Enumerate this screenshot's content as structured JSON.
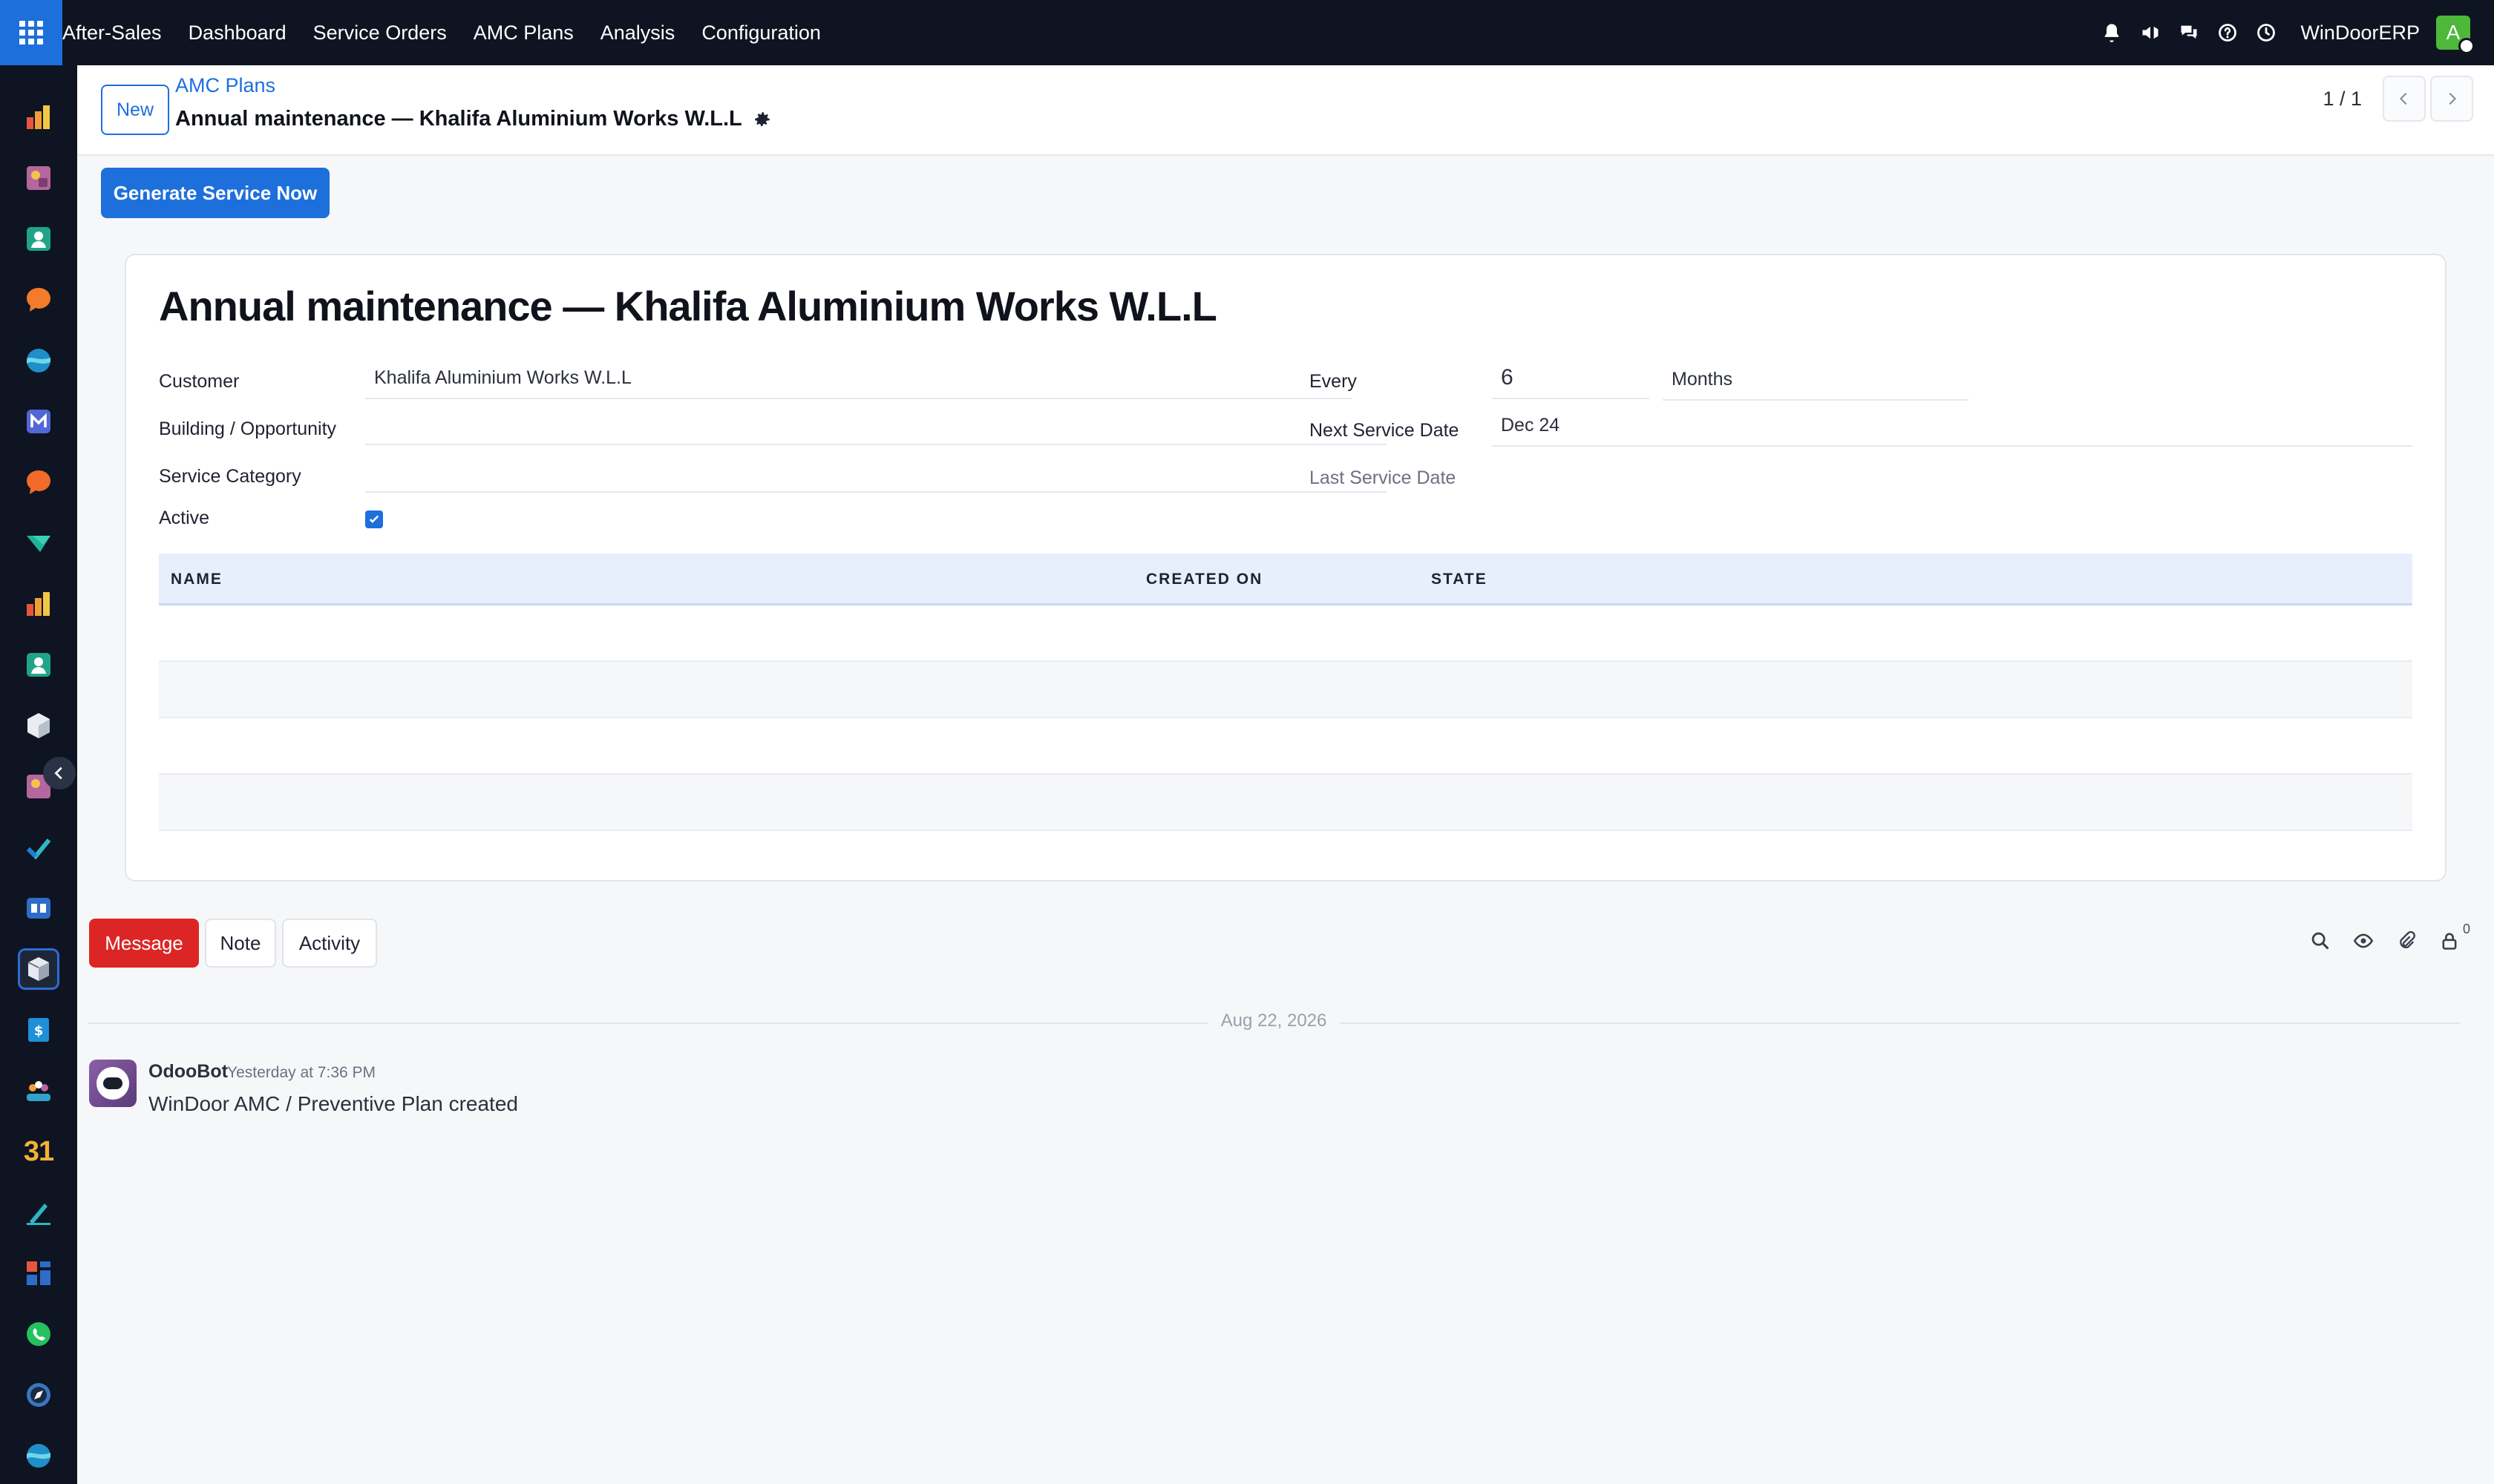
{
  "topbar": {
    "app_name": "After-Sales",
    "menu": [
      "Dashboard",
      "Service Orders",
      "AMC Plans",
      "Analysis",
      "Configuration"
    ],
    "company": "WinDoorERP",
    "avatar_letter": "A",
    "icons": [
      "bell-icon",
      "megaphone-icon",
      "chat-icon",
      "help-icon",
      "clock-icon"
    ]
  },
  "control": {
    "new_label": "New",
    "breadcrumb": "AMC Plans",
    "record_title": "Annual maintenance — Khalifa Aluminium Works W.L.L",
    "pager": "1 / 1"
  },
  "actions": {
    "generate_label": "Generate Service Now"
  },
  "form": {
    "title": "Annual maintenance — Khalifa Aluminium Works W.L.L",
    "customer_label": "Customer",
    "customer_value": "Khalifa Aluminium Works W.L.L",
    "building_label": "Building / Opportunity",
    "building_value": "",
    "category_label": "Service Category",
    "category_value": "",
    "active_label": "Active",
    "active": true,
    "every_label": "Every",
    "every_value": "6",
    "every_unit": "Months",
    "next_label": "Next Service Date",
    "next_value": "Dec 24",
    "last_label": "Last Service Date",
    "last_value": ""
  },
  "table": {
    "columns": [
      "NAME",
      "CREATED ON",
      "STATE"
    ],
    "rows": []
  },
  "chatter": {
    "message_label": "Message",
    "note_label": "Note",
    "activity_label": "Activity",
    "followers_count": "0",
    "date_separator": "Aug 22, 2026",
    "messages": [
      {
        "author": "OdooBot",
        "time": "Yesterday at 7:36 PM",
        "body": "WinDoor AMC / Preventive Plan created"
      }
    ]
  },
  "colors": {
    "primary": "#1d6fdc",
    "topbar": "#0e1421",
    "message_button": "#dc2626"
  }
}
